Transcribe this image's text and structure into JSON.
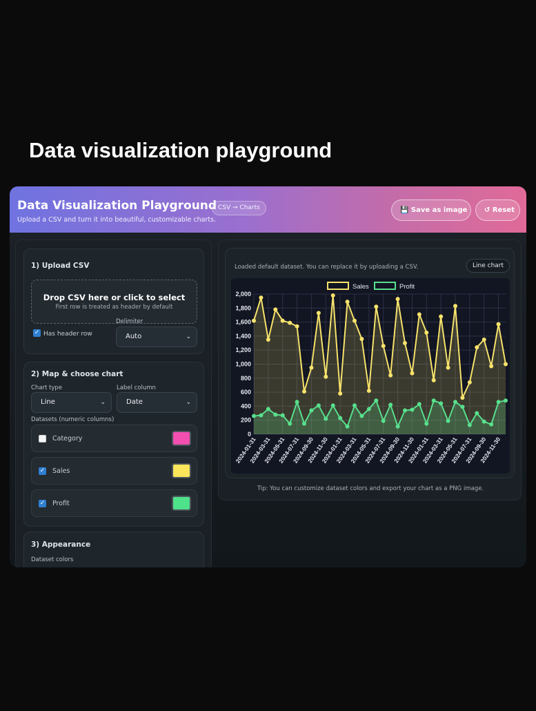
{
  "page_heading": "Data visualization playground",
  "header": {
    "title": "Data Visualization Playground",
    "badge": "CSV → Charts",
    "subtitle": "Upload a CSV and turn it into beautiful, customizable charts.",
    "save_label": "💾 Save as image",
    "reset_label": "↺ Reset"
  },
  "upload": {
    "title": "1) Upload CSV",
    "drop_main": "Drop CSV here or click to select",
    "drop_sub": "First row is treated as header by default",
    "has_header_label": "Has header row",
    "has_header_checked": true,
    "delimiter_label": "Delimiter",
    "delimiter_value": "Auto"
  },
  "map": {
    "title": "2) Map & choose chart",
    "chart_type_label": "Chart type",
    "chart_type_value": "Line",
    "label_column_label": "Label column",
    "label_column_value": "Date",
    "datasets_label": "Datasets (numeric columns)",
    "datasets": [
      {
        "name": "Category",
        "checked": false,
        "color": "#f24fb0"
      },
      {
        "name": "Sales",
        "checked": true,
        "color": "#fbe55a"
      },
      {
        "name": "Profit",
        "checked": true,
        "color": "#4ee28a"
      }
    ]
  },
  "appearance": {
    "title": "3) Appearance",
    "dataset_colors_label": "Dataset colors"
  },
  "chart_panel": {
    "status": "Loaded default dataset. You can replace it by uploading a CSV.",
    "chart_type_pill": "Line chart",
    "tip": "Tip: You can customize dataset colors and export your chart as a PNG image."
  },
  "chart_data": {
    "type": "line",
    "x": [
      "2024-01-31",
      "2024-02-29",
      "2024-03-31",
      "2024-04-30",
      "2024-05-31",
      "2024-06-30",
      "2024-07-31",
      "2024-08-31",
      "2024-09-30",
      "2024-10-31",
      "2024-11-30",
      "2024-12-31",
      "2024-01-31",
      "2024-02-29",
      "2024-03-31",
      "2024-04-30",
      "2024-05-31",
      "2024-06-30",
      "2024-07-31",
      "2024-08-31",
      "2024-09-30",
      "2024-10-31",
      "2024-11-30",
      "2024-12-31",
      "2024-01-31",
      "2024-02-29",
      "2024-03-31",
      "2024-04-30",
      "2024-05-31",
      "2024-06-30",
      "2024-07-31",
      "2024-08-31",
      "2024-09-30",
      "2024-10-31",
      "2024-11-30",
      "2024-12-31"
    ],
    "tick_labels": [
      "2024-01-31",
      "2024-03-31",
      "2024-05-31",
      "2024-07-31",
      "2024-09-30",
      "2024-11-30",
      "2024-01-31",
      "2024-03-31",
      "2024-05-31",
      "2024-07-31",
      "2024-09-30",
      "2024-11-30",
      "2024-01-31",
      "2024-03-31",
      "2024-05-31",
      "2024-07-31",
      "2024-09-30",
      "2024-11-30"
    ],
    "series": [
      {
        "name": "Sales",
        "color": "#f7e36b",
        "values": [
          1620,
          1950,
          1350,
          1780,
          1620,
          1590,
          1540,
          610,
          950,
          1730,
          820,
          1980,
          580,
          1890,
          1620,
          1360,
          620,
          1820,
          1260,
          840,
          1930,
          1300,
          870,
          1710,
          1450,
          770,
          1680,
          950,
          1830,
          520,
          740,
          1240,
          1350,
          970,
          1570,
          1000
        ]
      },
      {
        "name": "Profit",
        "color": "#58e08d",
        "values": [
          260,
          270,
          360,
          280,
          270,
          150,
          460,
          150,
          340,
          410,
          220,
          410,
          230,
          110,
          410,
          260,
          360,
          480,
          190,
          420,
          110,
          340,
          350,
          430,
          150,
          480,
          440,
          190,
          460,
          390,
          130,
          300,
          180,
          140,
          460,
          480
        ]
      }
    ],
    "ylim": [
      0,
      2000
    ],
    "yticks": [
      0,
      200,
      400,
      600,
      800,
      1000,
      1200,
      1400,
      1600,
      1800,
      2000
    ],
    "grid": true,
    "legend": "top"
  }
}
